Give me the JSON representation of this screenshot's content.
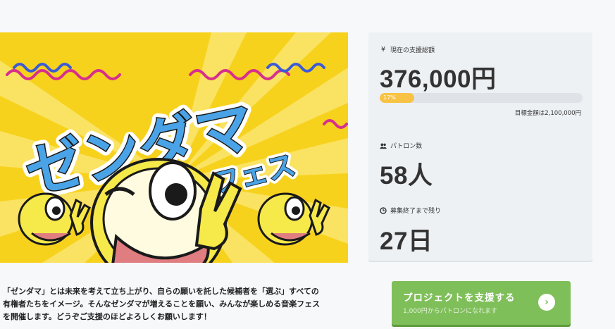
{
  "hero": {
    "title_main": "ゼンダマ",
    "title_sub": "フェス",
    "alt": "ゼンダマフェス"
  },
  "stats": {
    "total": {
      "icon": "yen-icon",
      "label": "現在の支援総額",
      "value": "376,000円",
      "progress_label": "17%",
      "progress_fraction": 0.17,
      "goal": "目標金額は2,100,000円"
    },
    "patrons": {
      "icon": "people-icon",
      "label": "パトロン数",
      "value": "58人"
    },
    "remaining": {
      "icon": "clock-icon",
      "label": "募集終了まで残り",
      "value": "27日"
    }
  },
  "description": {
    "line1": "「ゼンダマ」とは未来を考えて立ち上がり、自らの願いを託した候補者を「選ぶ」すべての",
    "line2": "有権者たちをイメージ。そんなゼンダマが増えることを願い、みんなが楽しめる音楽フェス",
    "line3": "を開催します。どうぞご支援のほどよろしくお願いします！"
  },
  "cta": {
    "title": "プロジェクトを支援する",
    "subtitle": "1,000円からパトロンになれます"
  },
  "colors": {
    "accent_green": "#7fbf5a",
    "progress_yellow": "#f8c244",
    "hero_yellow": "#f7d21d",
    "title_blue": "#4aa3e6"
  }
}
